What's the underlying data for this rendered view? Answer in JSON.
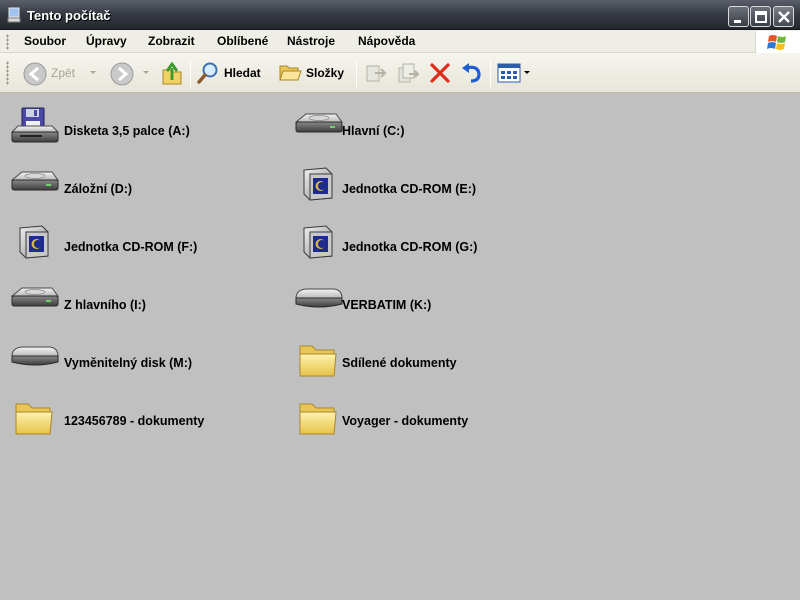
{
  "window": {
    "title": "Tento počítač"
  },
  "menu": [
    "Soubor",
    "Úpravy",
    "Zobrazit",
    "Oblíbené",
    "Nástroje",
    "Nápověda"
  ],
  "toolbar": {
    "back_label": "Zpět",
    "search_label": "Hledat",
    "folders_label": "Složky"
  },
  "items": [
    {
      "label": "Disketa 3,5 palce (A:)",
      "icon": "floppy-drive-icon"
    },
    {
      "label": "Hlavní (C:)",
      "icon": "hard-disk-icon"
    },
    {
      "label": "Záložní (D:)",
      "icon": "hard-disk-icon"
    },
    {
      "label": "Jednotka CD-ROM (E:)",
      "icon": "cdrom-drive-icon"
    },
    {
      "label": "Jednotka CD-ROM (F:)",
      "icon": "cdrom-drive-icon"
    },
    {
      "label": "Jednotka CD-ROM (G:)",
      "icon": "cdrom-drive-icon"
    },
    {
      "label": "Z hlavního (I:)",
      "icon": "hard-disk-icon"
    },
    {
      "label": "VERBATIM (K:)",
      "icon": "removable-disk-icon"
    },
    {
      "label": "Vyměnitelný disk (M:)",
      "icon": "removable-disk-icon"
    },
    {
      "label": "Sdílené dokumenty",
      "icon": "folder-icon"
    },
    {
      "label": "123456789 - dokumenty",
      "icon": "folder-icon"
    },
    {
      "label": "Voyager - dokumenty",
      "icon": "folder-icon"
    }
  ]
}
